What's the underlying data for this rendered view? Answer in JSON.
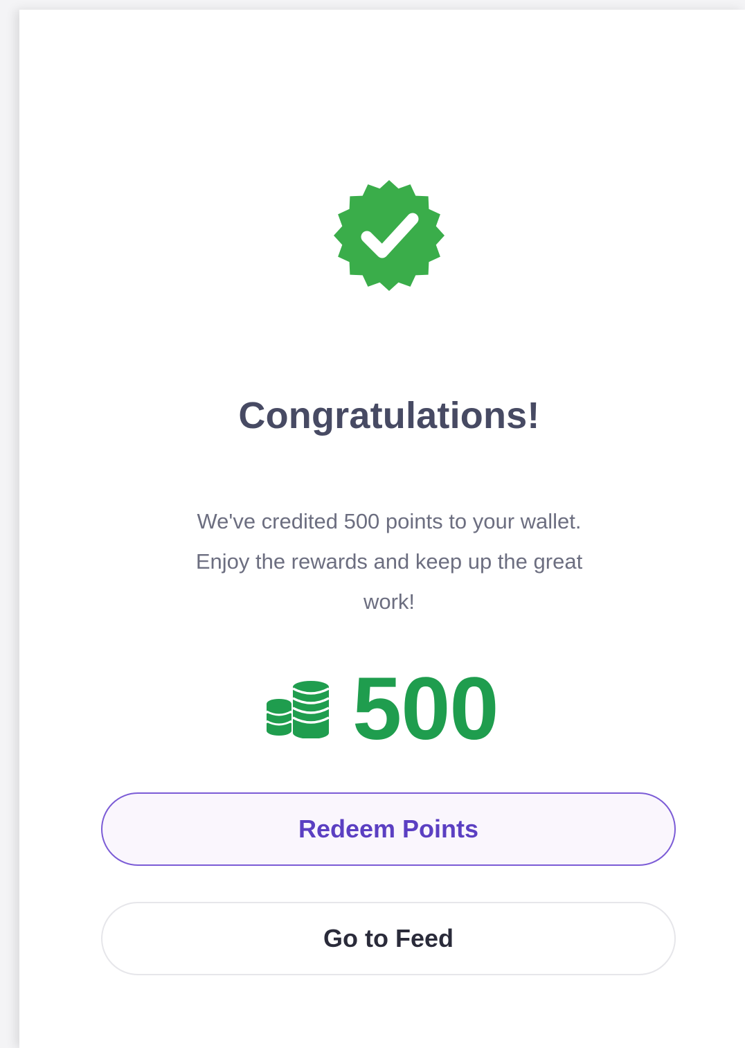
{
  "success": {
    "icon": "verified-check-badge-icon",
    "title": "Congratulations!",
    "message": "We've credited 500 points to your wallet. Enjoy the rewards and keep up the great work!"
  },
  "points": {
    "icon": "coin-stack-icon",
    "value": "500"
  },
  "actions": {
    "redeem_label": "Redeem Points",
    "feed_label": "Go to Feed"
  },
  "colors": {
    "success_green": "#1f9d4e",
    "badge_green": "#3aad4a",
    "primary_purple": "#5b3fc2",
    "title_text": "#474a63"
  }
}
